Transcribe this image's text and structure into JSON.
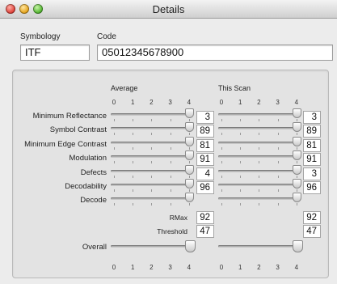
{
  "window": {
    "title": "Details"
  },
  "fields": {
    "symbology_label": "Symbology",
    "code_label": "Code",
    "symbology_value": "ITF",
    "code_value": "05012345678900"
  },
  "columns": {
    "average": "Average",
    "this_scan": "This Scan"
  },
  "scale_ticks": [
    "0",
    "1",
    "2",
    "3",
    "4"
  ],
  "rows": [
    {
      "label": "Minimum Reflectance",
      "average": {
        "value": "3",
        "level": 4
      },
      "scan": {
        "value": "3",
        "level": 4
      }
    },
    {
      "label": "Symbol Contrast",
      "average": {
        "value": "89",
        "level": 4
      },
      "scan": {
        "value": "89",
        "level": 4
      }
    },
    {
      "label": "Minimum Edge Contrast",
      "average": {
        "value": "81",
        "level": 4
      },
      "scan": {
        "value": "81",
        "level": 4
      }
    },
    {
      "label": "Modulation",
      "average": {
        "value": "91",
        "level": 4
      },
      "scan": {
        "value": "91",
        "level": 4
      }
    },
    {
      "label": "Defects",
      "average": {
        "value": "4",
        "level": 4
      },
      "scan": {
        "value": "3",
        "level": 4
      }
    },
    {
      "label": "Decodability",
      "average": {
        "value": "96",
        "level": 4
      },
      "scan": {
        "value": "96",
        "level": 4
      }
    },
    {
      "label": "Decode",
      "average": {
        "value": "",
        "level": 4
      },
      "scan": {
        "value": "",
        "level": 4
      }
    }
  ],
  "rmax": {
    "label": "RMax",
    "average": "92",
    "scan": "92"
  },
  "threshold": {
    "label": "Threshold",
    "average": "47",
    "scan": "47"
  },
  "overall": {
    "label": "Overall",
    "average_level": 4,
    "scan_level": 4
  }
}
